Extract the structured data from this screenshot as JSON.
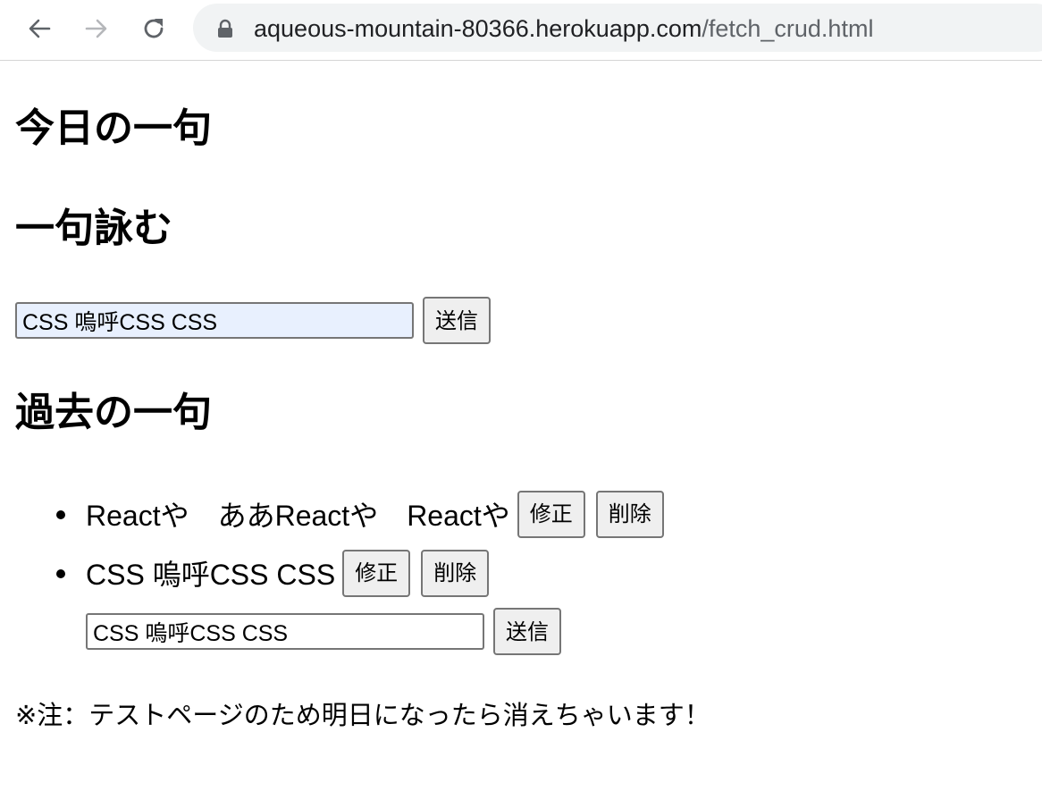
{
  "browser": {
    "url_host": "aqueous-mountain-80366.herokuapp.com",
    "url_path": "/fetch_crud.html",
    "icons": [
      "back-arrow-icon",
      "forward-arrow-icon",
      "reload-icon",
      "lock-icon"
    ]
  },
  "page": {
    "title": "今日の一句",
    "compose": {
      "heading": "一句詠む",
      "input_value": "CSS 嗚呼CSS CSS",
      "submit_label": "送信"
    },
    "past": {
      "heading": "過去の一句",
      "items": [
        {
          "text": "Reactや　ああReactや　Reactや",
          "edit_label": "修正",
          "delete_label": "削除"
        },
        {
          "text": "CSS 嗚呼CSS CSS",
          "edit_label": "修正",
          "delete_label": "削除"
        }
      ],
      "edit_form": {
        "input_value": "CSS 嗚呼CSS CSS",
        "submit_label": "送信"
      }
    },
    "note": "※注：テストページのため明日になったら消えちゃいます！"
  },
  "colors": {
    "omnibox_bg": "#f1f3f4",
    "autofill_bg": "#e8f0fe",
    "button_bg": "#efefef",
    "button_border": "#767676"
  }
}
